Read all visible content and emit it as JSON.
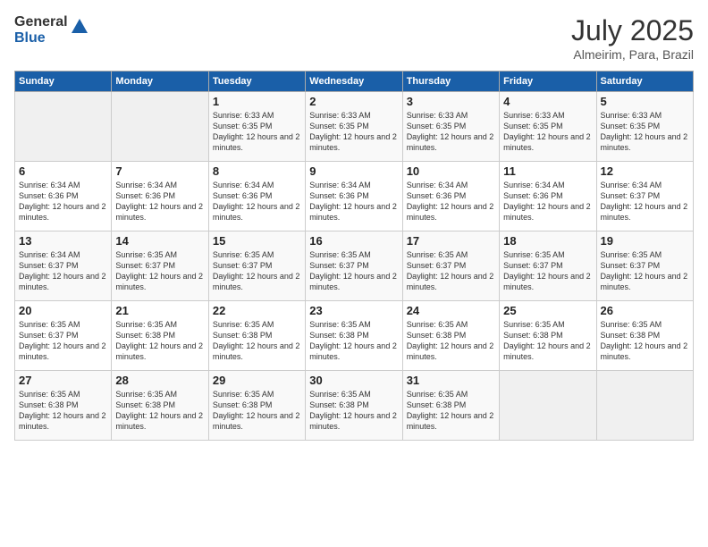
{
  "header": {
    "logo_general": "General",
    "logo_blue": "Blue",
    "month_title": "July 2025",
    "subtitle": "Almeirim, Para, Brazil"
  },
  "days_of_week": [
    "Sunday",
    "Monday",
    "Tuesday",
    "Wednesday",
    "Thursday",
    "Friday",
    "Saturday"
  ],
  "weeks": [
    [
      {
        "day": "",
        "empty": true
      },
      {
        "day": "",
        "empty": true
      },
      {
        "day": "1",
        "sunrise": "Sunrise: 6:33 AM",
        "sunset": "Sunset: 6:35 PM",
        "daylight": "Daylight: 12 hours and 2 minutes."
      },
      {
        "day": "2",
        "sunrise": "Sunrise: 6:33 AM",
        "sunset": "Sunset: 6:35 PM",
        "daylight": "Daylight: 12 hours and 2 minutes."
      },
      {
        "day": "3",
        "sunrise": "Sunrise: 6:33 AM",
        "sunset": "Sunset: 6:35 PM",
        "daylight": "Daylight: 12 hours and 2 minutes."
      },
      {
        "day": "4",
        "sunrise": "Sunrise: 6:33 AM",
        "sunset": "Sunset: 6:35 PM",
        "daylight": "Daylight: 12 hours and 2 minutes."
      },
      {
        "day": "5",
        "sunrise": "Sunrise: 6:33 AM",
        "sunset": "Sunset: 6:35 PM",
        "daylight": "Daylight: 12 hours and 2 minutes."
      }
    ],
    [
      {
        "day": "6",
        "sunrise": "Sunrise: 6:34 AM",
        "sunset": "Sunset: 6:36 PM",
        "daylight": "Daylight: 12 hours and 2 minutes."
      },
      {
        "day": "7",
        "sunrise": "Sunrise: 6:34 AM",
        "sunset": "Sunset: 6:36 PM",
        "daylight": "Daylight: 12 hours and 2 minutes."
      },
      {
        "day": "8",
        "sunrise": "Sunrise: 6:34 AM",
        "sunset": "Sunset: 6:36 PM",
        "daylight": "Daylight: 12 hours and 2 minutes."
      },
      {
        "day": "9",
        "sunrise": "Sunrise: 6:34 AM",
        "sunset": "Sunset: 6:36 PM",
        "daylight": "Daylight: 12 hours and 2 minutes."
      },
      {
        "day": "10",
        "sunrise": "Sunrise: 6:34 AM",
        "sunset": "Sunset: 6:36 PM",
        "daylight": "Daylight: 12 hours and 2 minutes."
      },
      {
        "day": "11",
        "sunrise": "Sunrise: 6:34 AM",
        "sunset": "Sunset: 6:36 PM",
        "daylight": "Daylight: 12 hours and 2 minutes."
      },
      {
        "day": "12",
        "sunrise": "Sunrise: 6:34 AM",
        "sunset": "Sunset: 6:37 PM",
        "daylight": "Daylight: 12 hours and 2 minutes."
      }
    ],
    [
      {
        "day": "13",
        "sunrise": "Sunrise: 6:34 AM",
        "sunset": "Sunset: 6:37 PM",
        "daylight": "Daylight: 12 hours and 2 minutes."
      },
      {
        "day": "14",
        "sunrise": "Sunrise: 6:35 AM",
        "sunset": "Sunset: 6:37 PM",
        "daylight": "Daylight: 12 hours and 2 minutes."
      },
      {
        "day": "15",
        "sunrise": "Sunrise: 6:35 AM",
        "sunset": "Sunset: 6:37 PM",
        "daylight": "Daylight: 12 hours and 2 minutes."
      },
      {
        "day": "16",
        "sunrise": "Sunrise: 6:35 AM",
        "sunset": "Sunset: 6:37 PM",
        "daylight": "Daylight: 12 hours and 2 minutes."
      },
      {
        "day": "17",
        "sunrise": "Sunrise: 6:35 AM",
        "sunset": "Sunset: 6:37 PM",
        "daylight": "Daylight: 12 hours and 2 minutes."
      },
      {
        "day": "18",
        "sunrise": "Sunrise: 6:35 AM",
        "sunset": "Sunset: 6:37 PM",
        "daylight": "Daylight: 12 hours and 2 minutes."
      },
      {
        "day": "19",
        "sunrise": "Sunrise: 6:35 AM",
        "sunset": "Sunset: 6:37 PM",
        "daylight": "Daylight: 12 hours and 2 minutes."
      }
    ],
    [
      {
        "day": "20",
        "sunrise": "Sunrise: 6:35 AM",
        "sunset": "Sunset: 6:37 PM",
        "daylight": "Daylight: 12 hours and 2 minutes."
      },
      {
        "day": "21",
        "sunrise": "Sunrise: 6:35 AM",
        "sunset": "Sunset: 6:38 PM",
        "daylight": "Daylight: 12 hours and 2 minutes."
      },
      {
        "day": "22",
        "sunrise": "Sunrise: 6:35 AM",
        "sunset": "Sunset: 6:38 PM",
        "daylight": "Daylight: 12 hours and 2 minutes."
      },
      {
        "day": "23",
        "sunrise": "Sunrise: 6:35 AM",
        "sunset": "Sunset: 6:38 PM",
        "daylight": "Daylight: 12 hours and 2 minutes."
      },
      {
        "day": "24",
        "sunrise": "Sunrise: 6:35 AM",
        "sunset": "Sunset: 6:38 PM",
        "daylight": "Daylight: 12 hours and 2 minutes."
      },
      {
        "day": "25",
        "sunrise": "Sunrise: 6:35 AM",
        "sunset": "Sunset: 6:38 PM",
        "daylight": "Daylight: 12 hours and 2 minutes."
      },
      {
        "day": "26",
        "sunrise": "Sunrise: 6:35 AM",
        "sunset": "Sunset: 6:38 PM",
        "daylight": "Daylight: 12 hours and 2 minutes."
      }
    ],
    [
      {
        "day": "27",
        "sunrise": "Sunrise: 6:35 AM",
        "sunset": "Sunset: 6:38 PM",
        "daylight": "Daylight: 12 hours and 2 minutes."
      },
      {
        "day": "28",
        "sunrise": "Sunrise: 6:35 AM",
        "sunset": "Sunset: 6:38 PM",
        "daylight": "Daylight: 12 hours and 2 minutes."
      },
      {
        "day": "29",
        "sunrise": "Sunrise: 6:35 AM",
        "sunset": "Sunset: 6:38 PM",
        "daylight": "Daylight: 12 hours and 2 minutes."
      },
      {
        "day": "30",
        "sunrise": "Sunrise: 6:35 AM",
        "sunset": "Sunset: 6:38 PM",
        "daylight": "Daylight: 12 hours and 2 minutes."
      },
      {
        "day": "31",
        "sunrise": "Sunrise: 6:35 AM",
        "sunset": "Sunset: 6:38 PM",
        "daylight": "Daylight: 12 hours and 2 minutes."
      },
      {
        "day": "",
        "empty": true
      },
      {
        "day": "",
        "empty": true
      }
    ]
  ]
}
